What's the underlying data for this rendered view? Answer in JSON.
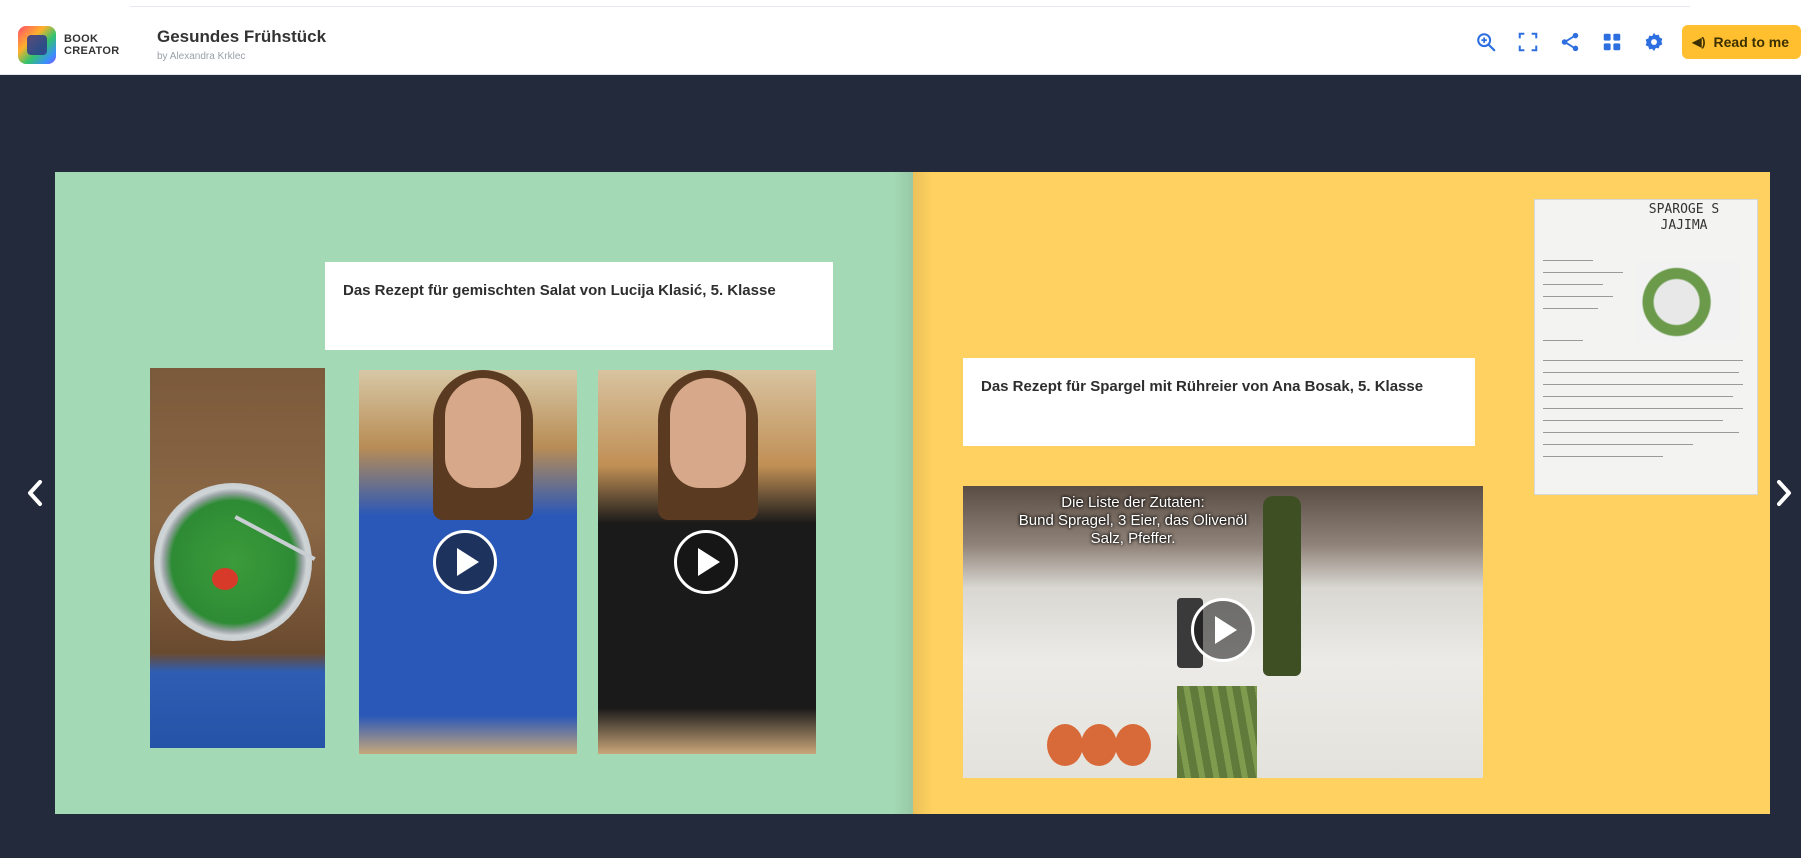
{
  "app": {
    "brand_line1": "BOOK",
    "brand_line2": "CREATOR",
    "book_title": "Gesundes Frühstück",
    "book_author": "by Alexandra Krklec"
  },
  "toolbar": {
    "icons": [
      "zoom-in-icon",
      "fullscreen-icon",
      "share-icon",
      "grid-icon",
      "gear-icon"
    ],
    "read_to_me_label": "Read to me",
    "accent_color": "#ffbf2e",
    "icon_color": "#2d6fe0"
  },
  "pages": {
    "left": {
      "background": "#a3d9b4",
      "caption": "Das Rezept für gemischten Salat von Lucija Klasić, 5. Klasse"
    },
    "right": {
      "background": "#ffd160",
      "caption": "Das Rezept für Spargel mit Rühreier von Ana Bosak, 5. Klasse",
      "video_subtitle_line1": "Die Liste der Zutaten:",
      "video_subtitle_line2": "Bund Spragel, 3 Eier, das Olivenöl",
      "video_subtitle_line3": "Salz, Pfeffer.",
      "recipe_title_line1": "SPAROGE S",
      "recipe_title_line2": "JAJIMA"
    }
  },
  "navigation": {
    "prev_icon": "chevron-left-icon",
    "next_icon": "chevron-right-icon"
  }
}
